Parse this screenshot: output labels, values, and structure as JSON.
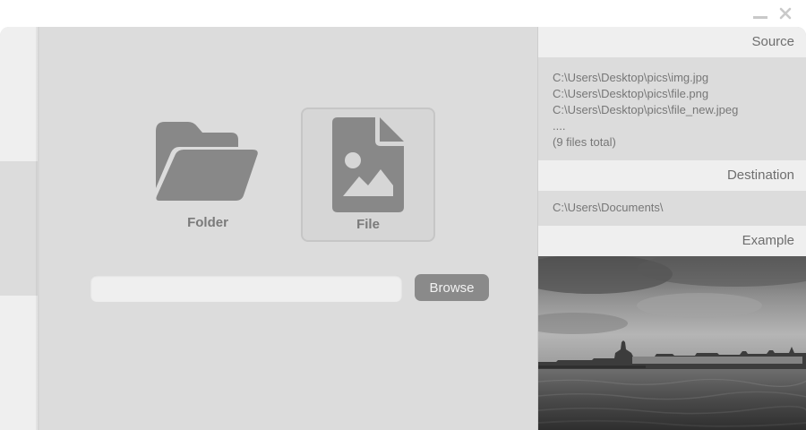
{
  "window": {
    "minimize_icon": "minimize-icon",
    "close_icon": "close-icon"
  },
  "main": {
    "options": [
      {
        "label": "Folder",
        "icon": "folder-open-icon",
        "selected": false
      },
      {
        "label": "File",
        "icon": "image-file-icon",
        "selected": true
      }
    ],
    "path_input": {
      "value": "",
      "placeholder": ""
    },
    "browse_label": "Browse"
  },
  "right": {
    "source": {
      "title": "Source",
      "files": [
        "C:\\Users\\Desktop\\pics\\img.jpg",
        "C:\\Users\\Desktop\\pics\\file.png",
        "C:\\Users\\Desktop\\pics\\file_new.jpeg",
        "....",
        "(9 files total)"
      ]
    },
    "destination": {
      "title": "Destination",
      "path": "C:\\Users\\Documents\\"
    },
    "example": {
      "title": "Example",
      "image": "grayscale waterfront photo"
    }
  },
  "colors": {
    "panel": "#dcdcdc",
    "header": "#efefef",
    "icon": "#888888",
    "button": "#8a8a8a"
  }
}
